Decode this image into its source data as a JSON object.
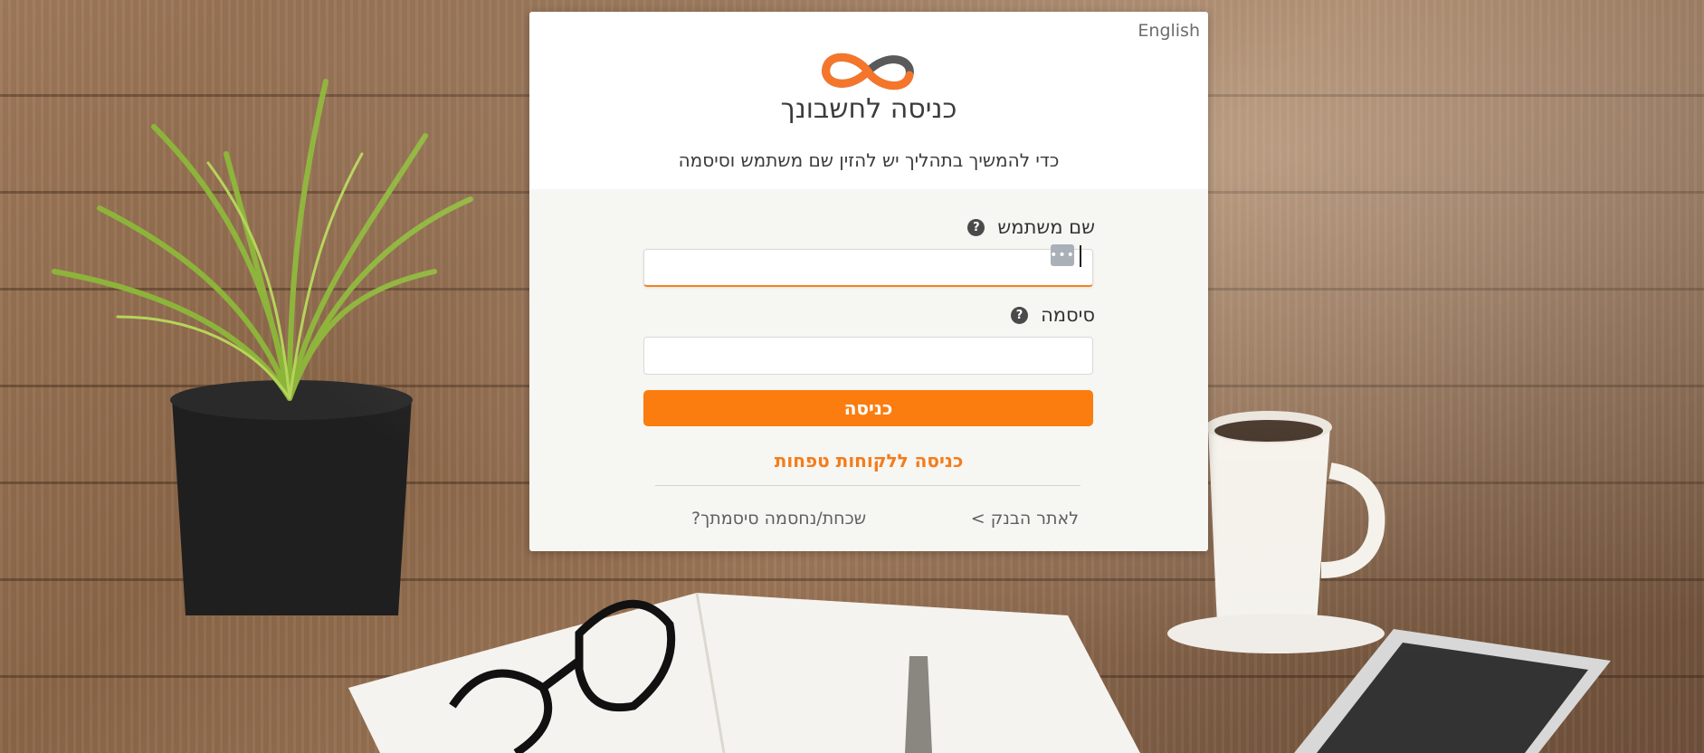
{
  "header": {
    "language_link": "English",
    "title": "כניסה לחשבונך",
    "subtitle": "כדי להמשיך בתהליך יש להזין שם משתמש וסיסמה"
  },
  "form": {
    "username": {
      "label": "שם משתמש",
      "value": "",
      "help_icon": "question-circle-icon"
    },
    "password": {
      "label": "סיסמה",
      "value": "",
      "help_icon": "question-circle-icon"
    },
    "submit_label": "כניסה"
  },
  "links": {
    "small_business": "כניסה ללקוחות טפחות",
    "bank_site": "לאתר הבנק >",
    "forgot_password": "שכחת/נחסמה סיסמתך?"
  },
  "colors": {
    "accent": "#fb7d0f",
    "logo_dark": "#5a5a5a",
    "logo_orange": "#f5762b"
  }
}
